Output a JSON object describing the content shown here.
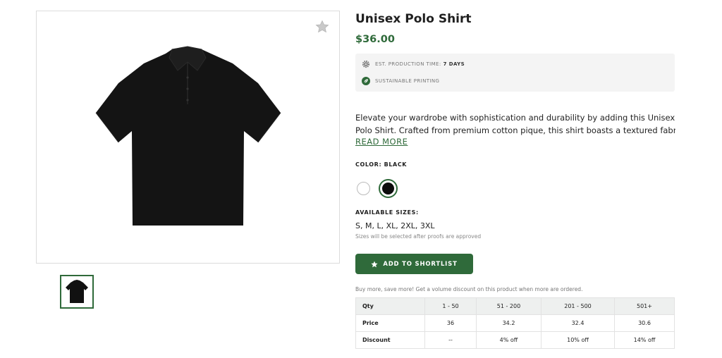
{
  "gallery": {
    "main_image_alt": "Black unisex polo shirt",
    "favorite_icon": "star-icon",
    "thumbnails": [
      {
        "alt": "Black polo shirt thumbnail",
        "selected": true
      }
    ]
  },
  "product": {
    "title": "Unisex Polo Shirt",
    "price": "$36.00",
    "production": {
      "time_label": "EST. PRODUCTION TIME:",
      "time_value": "7 DAYS",
      "sustainable_label": "SUSTAINABLE PRINTING"
    },
    "description_line1": "Elevate your wardrobe with sophistication and durability by adding this Unisex Pique",
    "description_line2": "Polo Shirt. Crafted from premium cotton pique, this shirt boasts a textured fabric th…",
    "read_more": "READ MORE",
    "color_label": "COLOR: BLACK",
    "colors": [
      {
        "name": "White",
        "hex": "#ffffff",
        "selected": false
      },
      {
        "name": "Black",
        "hex": "#0d0d0d",
        "selected": true
      }
    ],
    "sizes_label": "AVAILABLE SIZES:",
    "sizes": "S, M, L, XL, 2XL, 3XL",
    "sizes_note": "Sizes will be selected after proofs are approved",
    "shortlist_button": "ADD TO SHORTLIST",
    "volume_note": "Buy more, save more! Get a volume discount on this product when more are ordered."
  },
  "pricing_table": {
    "headers": [
      "Qty",
      "1 - 50",
      "51 - 200",
      "201 - 500",
      "501+"
    ],
    "rows": [
      [
        "Price",
        "36",
        "34.2",
        "32.4",
        "30.6"
      ],
      [
        "Discount",
        "--",
        "4% off",
        "10% off",
        "14% off"
      ]
    ]
  },
  "colors": {
    "accent": "#2f6a3a",
    "text": "#1f1f1f",
    "panel": "#f4f4f4"
  }
}
